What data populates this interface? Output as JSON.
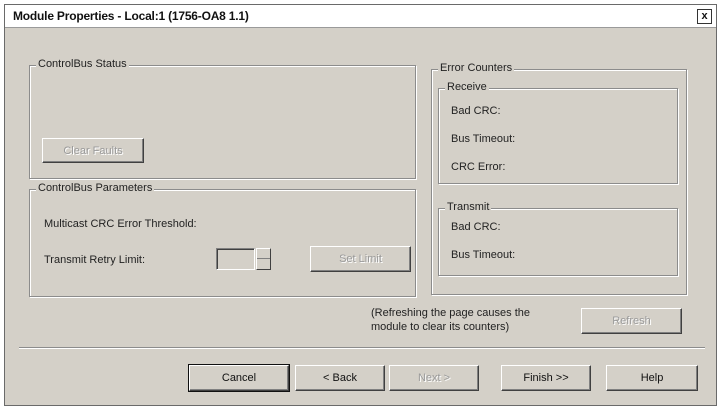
{
  "window": {
    "title": "Module Properties - Local:1 (1756-OA8 1.1)",
    "close_glyph": "x"
  },
  "controlbus_status": {
    "group_label": "ControlBus Status",
    "clear_faults_button": "Clear Faults"
  },
  "controlbus_parameters": {
    "group_label": "ControlBus Parameters",
    "multicast_label": "Multicast CRC Error Threshold:",
    "retry_label": "Transmit Retry Limit:",
    "retry_value": "",
    "set_limit_button": "Set Limit"
  },
  "error_counters": {
    "group_label": "Error Counters",
    "receive": {
      "group_label": "Receive",
      "bad_crc": "Bad CRC:",
      "bus_timeout": "Bus Timeout:",
      "crc_error": "CRC Error:"
    },
    "transmit": {
      "group_label": "Transmit",
      "bad_crc": "Bad CRC:",
      "bus_timeout": "Bus Timeout:"
    }
  },
  "refresh": {
    "note_line1": "(Refreshing the page causes the",
    "note_line2": "module to clear its counters)",
    "button": "Refresh"
  },
  "footer": {
    "cancel": "Cancel",
    "back": "< Back",
    "next": "Next >",
    "finish": "Finish >>",
    "help": "Help"
  }
}
